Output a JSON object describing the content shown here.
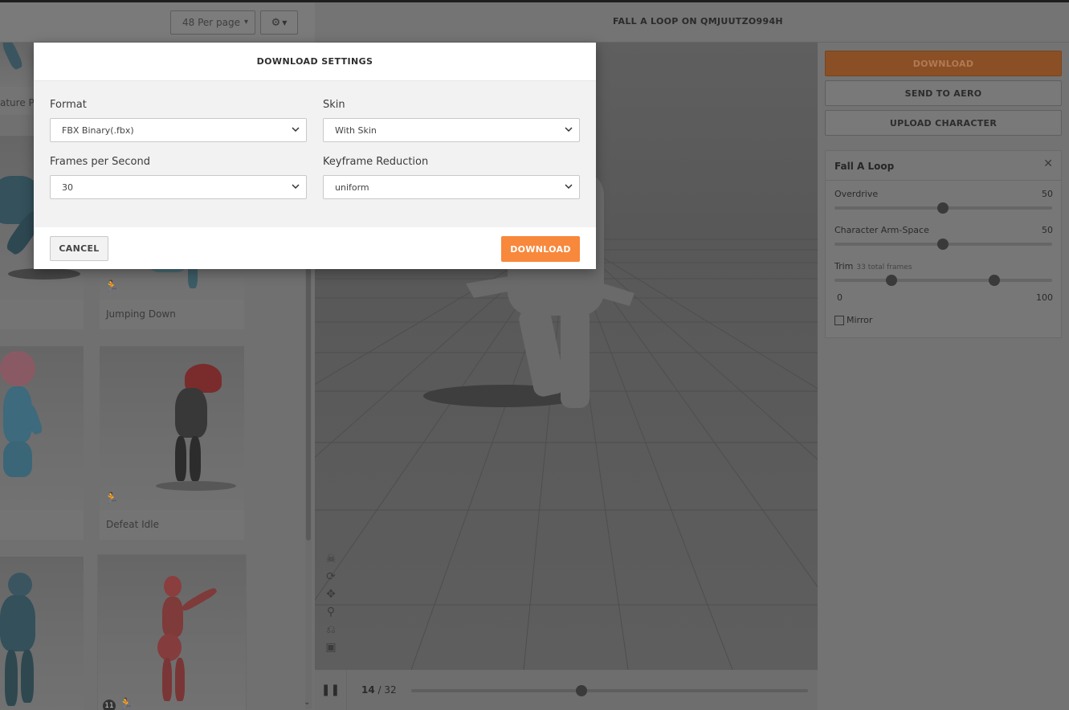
{
  "left": {
    "per_page": "48 Per page",
    "cards": [
      {
        "label": "ature Pa"
      },
      {
        "label": ""
      },
      {
        "label": "Jumping Down"
      },
      {
        "label": ""
      },
      {
        "label": "Defeat Idle"
      },
      {
        "label": ""
      },
      {
        "label": "",
        "badge": "11"
      }
    ]
  },
  "viewer": {
    "title": "FALL A LOOP ON QMJUUTZO994H",
    "frame_current": "14",
    "frame_total": "/ 32",
    "progress": 0.43
  },
  "right": {
    "download": "DOWNLOAD",
    "send_to_aero": "SEND TO AERO",
    "upload_character": "UPLOAD CHARACTER",
    "anim_title": "Fall A Loop",
    "close": "✕",
    "overdrive": {
      "label": "Overdrive",
      "value": "50"
    },
    "arm_space": {
      "label": "Character Arm-Space",
      "value": "50"
    },
    "trim": {
      "label": "Trim",
      "sub": "33 total frames",
      "min": "0",
      "max": "100"
    },
    "mirror": "Mirror"
  },
  "modal": {
    "title": "DOWNLOAD SETTINGS",
    "format_label": "Format",
    "format_value": "FBX Binary(.fbx)",
    "skin_label": "Skin",
    "skin_value": "With Skin",
    "fps_label": "Frames per Second",
    "fps_value": "30",
    "keyframe_label": "Keyframe Reduction",
    "keyframe_value": "uniform",
    "cancel": "CANCEL",
    "download": "DOWNLOAD"
  },
  "colors": {
    "accent": "#f7883c",
    "overlay": "#595959"
  }
}
